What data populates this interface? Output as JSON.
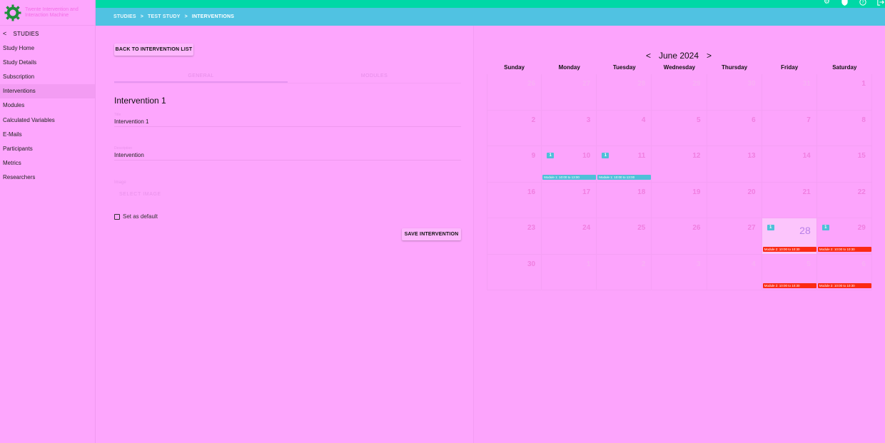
{
  "app": {
    "name": "Twente Intervention and Interaction Machine",
    "colors": {
      "topbar": "#00d8a6",
      "breadcrumb_bar": "#50c2e2",
      "event_blue": "#4ec0d8",
      "event_red": "#fb2a14"
    }
  },
  "top_icons": [
    "gear-icon",
    "shield-icon",
    "help-icon",
    "logout-icon"
  ],
  "breadcrumb": [
    "STUDIES",
    "TEST STUDY",
    "INTERVENTIONS"
  ],
  "sidebar": {
    "back_label": "STUDIES",
    "items": [
      {
        "label": "Study Home"
      },
      {
        "label": "Study Details"
      },
      {
        "label": "Subscription"
      },
      {
        "label": "Interventions",
        "active": true
      },
      {
        "label": "Modules"
      },
      {
        "label": "Calculated Variables"
      },
      {
        "label": "E-Mails"
      },
      {
        "label": "Participants"
      },
      {
        "label": "Metrics"
      },
      {
        "label": "Researchers"
      }
    ]
  },
  "form": {
    "back_button": "BACK TO INTERVENTION LIST",
    "tabs": [
      "GENERAL",
      "MODULES"
    ],
    "title": "Intervention 1",
    "fields": {
      "title_label": "Title",
      "title_value": "Intervention 1",
      "description_label": "Description",
      "description_value": "Intervention",
      "image_label": "Image",
      "select_image": "SELECT IMAGE"
    },
    "default_checkbox": "Set as default",
    "save_button": "SAVE INTERVENTION"
  },
  "calendar": {
    "month": "June 2024",
    "prev_icon": "<",
    "next_icon": ">",
    "weekdays": [
      "Sunday",
      "Monday",
      "Tuesday",
      "Wednesday",
      "Thursday",
      "Friday",
      "Saturday"
    ],
    "weeks": [
      [
        {
          "n": "26",
          "faded": true
        },
        {
          "n": "27",
          "faded": true
        },
        {
          "n": "28",
          "faded": true
        },
        {
          "n": "29",
          "faded": true
        },
        {
          "n": "30",
          "faded": true
        },
        {
          "n": "31",
          "faded": true
        },
        {
          "n": "1"
        }
      ],
      [
        {
          "n": "2"
        },
        {
          "n": "3"
        },
        {
          "n": "4"
        },
        {
          "n": "5"
        },
        {
          "n": "6"
        },
        {
          "n": "7"
        },
        {
          "n": "8"
        }
      ],
      [
        {
          "n": "9"
        },
        {
          "n": "10",
          "badge": "1"
        },
        {
          "n": "11",
          "badge": "1"
        },
        {
          "n": "12"
        },
        {
          "n": "13"
        },
        {
          "n": "14"
        },
        {
          "n": "15"
        }
      ],
      [
        {
          "n": "16"
        },
        {
          "n": "17"
        },
        {
          "n": "18"
        },
        {
          "n": "19"
        },
        {
          "n": "20"
        },
        {
          "n": "21"
        },
        {
          "n": "22"
        }
      ],
      [
        {
          "n": "23"
        },
        {
          "n": "24"
        },
        {
          "n": "25"
        },
        {
          "n": "26"
        },
        {
          "n": "27"
        },
        {
          "n": "28",
          "today": true,
          "badge": "1"
        },
        {
          "n": "29",
          "badge": "1"
        }
      ],
      [
        {
          "n": "30"
        },
        {
          "n": "1",
          "faded": true
        },
        {
          "n": "2",
          "faded": true
        },
        {
          "n": "3",
          "faded": true
        },
        {
          "n": "4",
          "faded": true
        },
        {
          "n": "5",
          "faded": true
        },
        {
          "n": "6",
          "faded": true
        }
      ]
    ],
    "events": [
      {
        "week": 2,
        "day": 1,
        "label": "Module 1: 10:00 to 13:00",
        "color": "blue"
      },
      {
        "week": 2,
        "day": 2,
        "label": "Module 1: 10:00 to 13:00",
        "color": "blue"
      },
      {
        "week": 4,
        "day": 5,
        "label": "Module 2: 10:00 to 10:30",
        "color": "red"
      },
      {
        "week": 4,
        "day": 6,
        "label": "Module 2: 10:00 to 10:30",
        "color": "red"
      },
      {
        "week": 5,
        "day": 5,
        "label": "Module 2: 10:00 to 10:30",
        "color": "red"
      },
      {
        "week": 5,
        "day": 6,
        "label": "Module 2: 10:00 to 10:30",
        "color": "red"
      }
    ]
  }
}
